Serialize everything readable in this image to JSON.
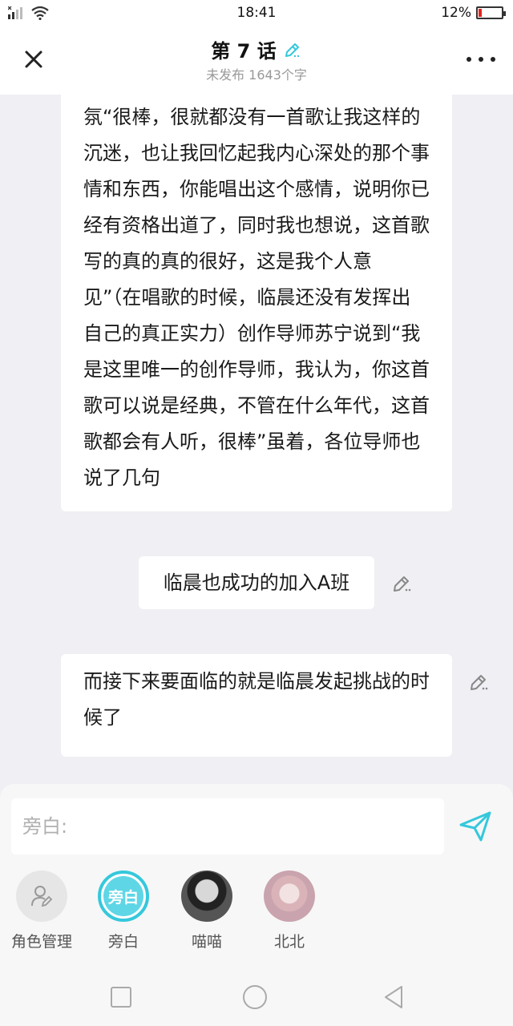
{
  "status_bar": {
    "time": "18:41",
    "battery": "12%",
    "battery_level": 0.12,
    "colors": {
      "battery_low": "#e0261f"
    }
  },
  "header": {
    "title": "第 7 话",
    "subtitle": "未发布 1643个字",
    "accent": "#35c8dc"
  },
  "messages": [
    {
      "text": "氛“很棒，很就都没有一首歌让我这样的沉迷，也让我回忆起我内心深处的那个事情和东西，你能唱出这个感情，说明你已经有资格出道了，同时我也想说，这首歌写的真的真的很好，这是我个人意见”（在唱歌的时候，临晨还没有发挥出自己的真正实力）创作导师苏宁说到“我是这里唯一的创作导师，我认为，你这首歌可以说是经典，不管在什么年代，这首歌都会有人听，很棒”虽着，各位导师也说了几句"
    },
    {
      "text": "临晨也成功的加入A班"
    },
    {
      "text": "而接下来要面临的就是临晨发起挑战的时候了"
    }
  ],
  "input": {
    "placeholder": "旁白:",
    "value": ""
  },
  "roles": [
    {
      "label": "角色管理",
      "icon": "role-manage-icon"
    },
    {
      "label": "旁白",
      "avatar_text": "旁白"
    },
    {
      "label": "喵喵"
    },
    {
      "label": "北北"
    }
  ]
}
